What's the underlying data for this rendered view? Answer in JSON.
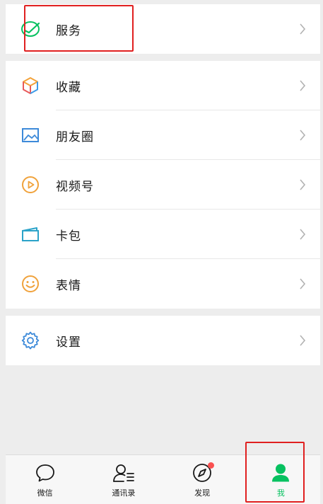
{
  "menu": {
    "service": "服务",
    "items": [
      {
        "label": "收藏",
        "icon": "favorites-cube-icon"
      },
      {
        "label": "朋友圈",
        "icon": "moments-picture-icon"
      },
      {
        "label": "视频号",
        "icon": "channels-play-icon"
      },
      {
        "label": "卡包",
        "icon": "card-wallet-icon"
      },
      {
        "label": "表情",
        "icon": "sticker-smiley-icon"
      }
    ],
    "settings": "设置"
  },
  "tabbar": {
    "chats": "微信",
    "contacts": "通讯录",
    "discover": "发现",
    "me": "我"
  },
  "colors": {
    "accent": "#07c160",
    "badge": "#fa5151",
    "highlight": "#e02020"
  }
}
